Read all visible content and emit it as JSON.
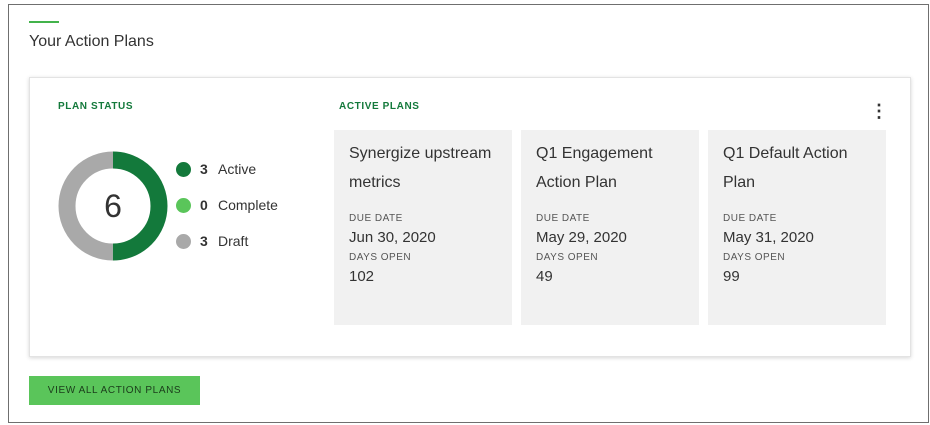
{
  "header": {
    "title": "Your Action Plans"
  },
  "card": {
    "plan_status_label": "PLAN STATUS",
    "active_plans_label": "ACTIVE PLANS",
    "more_icon": "more-vertical-icon"
  },
  "plan_status": {
    "total": "6",
    "legend": [
      {
        "count": "3",
        "label": "Active",
        "color": "#13793b"
      },
      {
        "count": "0",
        "label": "Complete",
        "color": "#5ac55a"
      },
      {
        "count": "3",
        "label": "Draft",
        "color": "#a9a9a9"
      }
    ]
  },
  "active_plans": [
    {
      "name": "Synergize upstream metrics",
      "due_label": "DUE DATE",
      "due_date": "Jun 30, 2020",
      "days_open_label": "DAYS OPEN",
      "days_open": "102"
    },
    {
      "name": "Q1 Engagement Action Plan",
      "due_label": "DUE DATE",
      "due_date": "May 29, 2020",
      "days_open_label": "DAYS OPEN",
      "days_open": "49"
    },
    {
      "name": "Q1 Default Action Plan",
      "due_label": "DUE DATE",
      "due_date": "May 31, 2020",
      "days_open_label": "DAYS OPEN",
      "days_open": "99"
    }
  ],
  "footer": {
    "view_all_label": "VIEW ALL ACTION PLANS"
  },
  "colors": {
    "accent": "#43b34b",
    "brand_dark_green": "#13793b",
    "button_green": "#5ac55a",
    "draft_gray": "#a9a9a9"
  }
}
